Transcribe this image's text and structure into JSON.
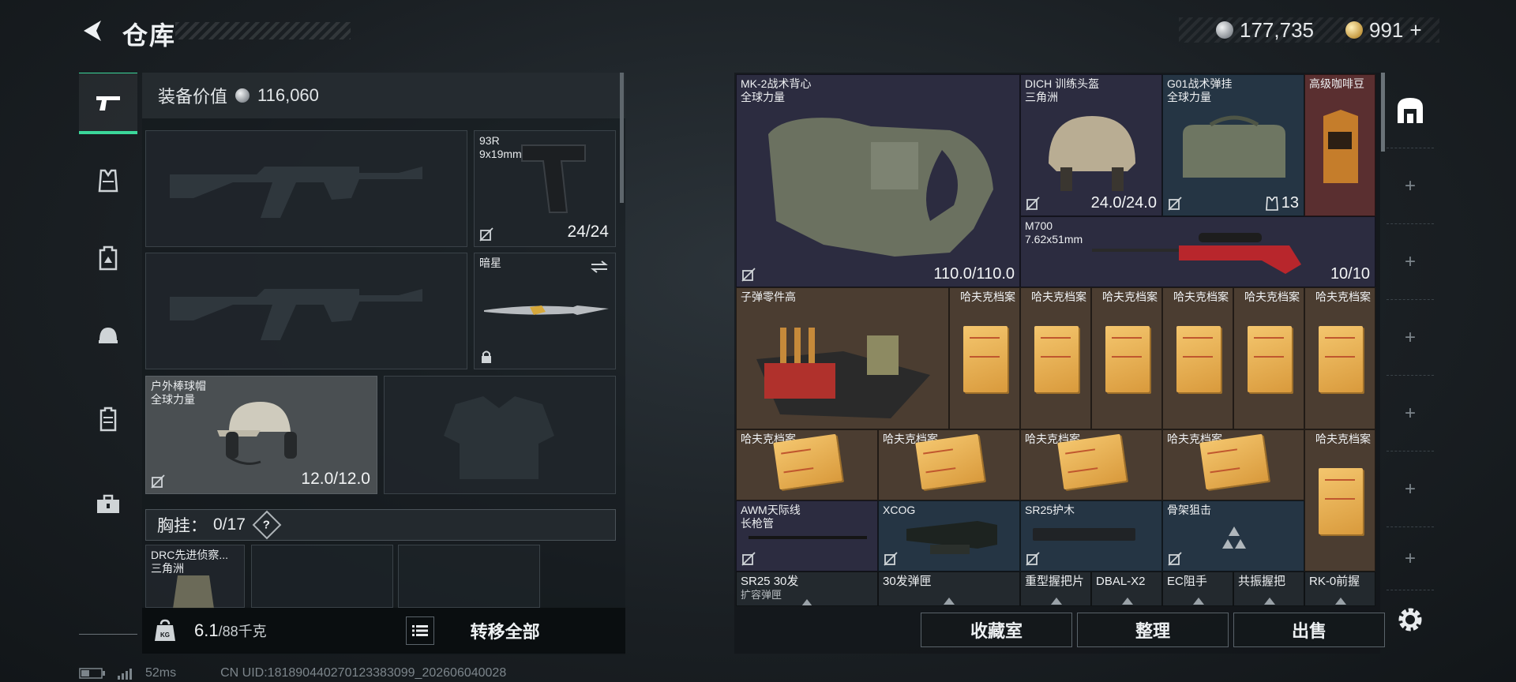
{
  "header": {
    "title": "仓库",
    "silver_balance": "177,735",
    "gold_balance": "991",
    "gold_plus": "+"
  },
  "left_nav": [
    "pistol-icon",
    "vest-icon",
    "backpack-icon",
    "helmet-icon",
    "armor-icon",
    "toolbox-icon"
  ],
  "equipment": {
    "value_label": "装备价值",
    "value": "116,060",
    "pistol": {
      "name": "93R",
      "caliber": "9x19mm",
      "ammo": "24/24"
    },
    "melee": {
      "name": "暗星"
    },
    "helmet": {
      "name": "户外棒球帽",
      "origin": "全球力量",
      "durability": "12.0/12.0"
    },
    "chest_label": "胸挂：",
    "chest_capacity": "0/17",
    "help": "?",
    "rig": {
      "name": "DRC先进侦察...",
      "origin": "三角洲"
    },
    "weight": "6.1",
    "weight_max": "/88千克",
    "transfer_all": "转移全部"
  },
  "stash": {
    "vest": {
      "name": "MK-2战术背心",
      "origin": "全球力量",
      "durability": "110.0/110.0"
    },
    "helmet": {
      "name": "DICH 训练头盔",
      "origin": "三角洲",
      "durability": "24.0/24.0"
    },
    "bag": {
      "name": "G01战术弹挂",
      "origin": "全球力量",
      "count": "13"
    },
    "coffee": {
      "name": "高级咖啡豆"
    },
    "rifle": {
      "name": "M700",
      "caliber": "7.62x51mm",
      "ammo": "10/10"
    },
    "ammo_parts": {
      "name": "子弹零件高"
    },
    "file_label": "哈夫克档案",
    "awm": {
      "name": "AWM天际线",
      "sub": "长枪管"
    },
    "xcog": {
      "name": "XCOG"
    },
    "sr25": {
      "name": "SR25护木"
    },
    "bipod": {
      "name": "骨架狙击"
    },
    "bottom_row": [
      "SR25 30发",
      "30发弹匣",
      "重型握把片",
      "DBAL-X2",
      "EC阻手",
      "共振握把",
      "RK-0前握"
    ],
    "bottom_sub": "扩容弹匣"
  },
  "actions": {
    "collection": "收藏室",
    "sort": "整理",
    "sell": "出售"
  },
  "status": {
    "ping": "52ms",
    "uid": "CN UID:181890440270123383099_202606040028"
  }
}
